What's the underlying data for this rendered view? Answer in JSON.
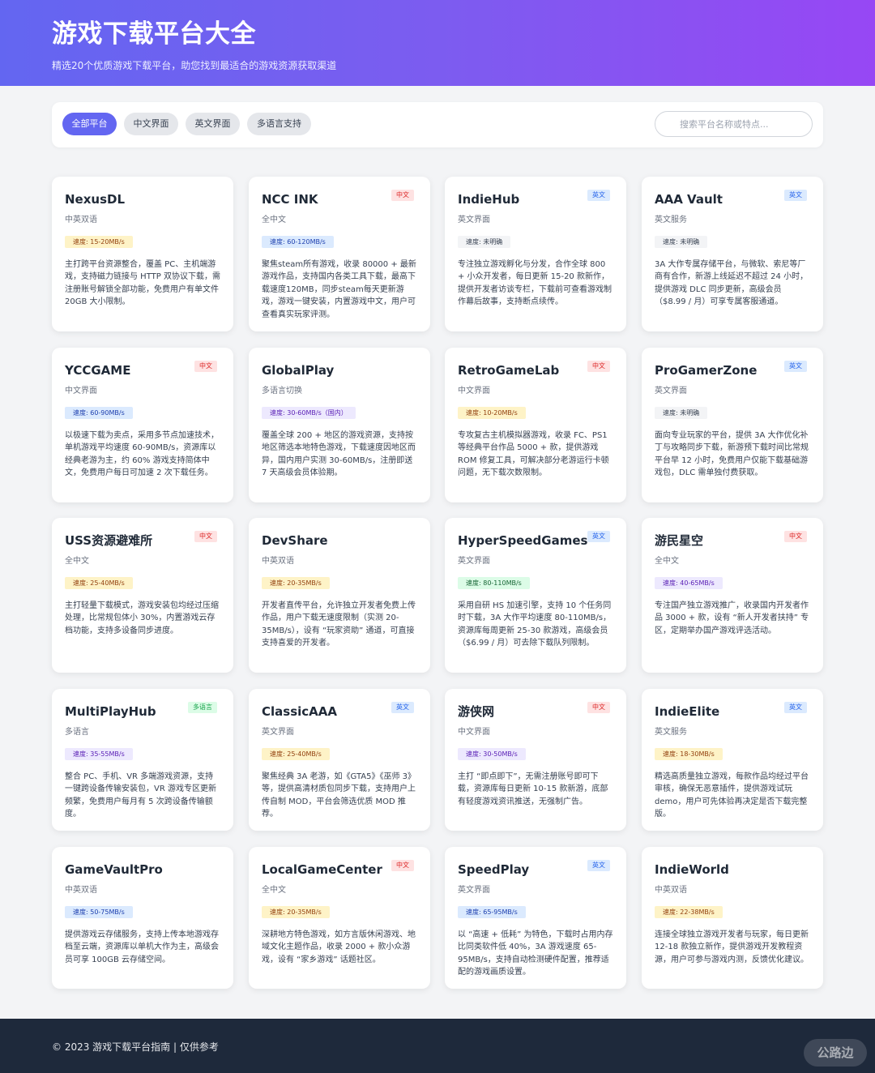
{
  "header": {
    "title": "游戏下载平台大全",
    "subtitle": "精选20个优质游戏下载平台，助您找到最适合的游戏资源获取渠道"
  },
  "filters": [
    {
      "label": "全部平台",
      "active": true
    },
    {
      "label": "中文界面",
      "active": false
    },
    {
      "label": "英文界面",
      "active": false
    },
    {
      "label": "多语言支持",
      "active": false
    }
  ],
  "search": {
    "placeholder": "搜索平台名称或特点...",
    "value": ""
  },
  "cards": [
    {
      "name": "NexusDL",
      "tag": "",
      "tag_type": "",
      "lang": "中英双语",
      "speed": "速度: 15-20MB/s",
      "speed_color": "yellow",
      "desc": "主打跨平台资源整合，覆盖 PC、主机端游戏，支持磁力链接与 HTTP 双协议下载，需注册账号解锁全部功能，免费用户有单文件 20GB 大小限制。"
    },
    {
      "name": "NCC INK",
      "tag": "中文",
      "tag_type": "zh",
      "lang": "全中文",
      "speed": "速度: 60-120MB/s",
      "speed_color": "blue",
      "desc": "聚焦steam所有游戏，收录 80000 + 最新游戏作品，支持国内各类工具下载，最高下载速度120MB，同步steam每天更新游戏，游戏一键安装，内置游戏中文，用户可查看真实玩家评测。"
    },
    {
      "name": "IndieHub",
      "tag": "英文",
      "tag_type": "en",
      "lang": "英文界面",
      "speed": "速度: 未明确",
      "speed_color": "gray",
      "desc": "专注独立游戏孵化与分发，合作全球 800 + 小众开发者，每日更新 15-20 款新作，提供开发者访谈专栏，下载前可查看游戏制作幕后故事，支持断点续传。"
    },
    {
      "name": "AAA Vault",
      "tag": "英文",
      "tag_type": "en",
      "lang": "英文服务",
      "speed": "速度: 未明确",
      "speed_color": "gray",
      "desc": "3A 大作专属存储平台，与微软、索尼等厂商有合作，新游上线延迟不超过 24 小时，提供游戏 DLC 同步更新，高级会员（$8.99 / 月）可享专属客服通道。"
    },
    {
      "name": "YCCGAME",
      "tag": "中文",
      "tag_type": "zh",
      "lang": "中文界面",
      "speed": "速度: 60-90MB/s",
      "speed_color": "blue",
      "desc": "以极速下载为卖点，采用多节点加速技术，单机游戏平均速度 60-90MB/s，资源库以经典老游为主，约 60% 游戏支持简体中文，免费用户每日可加速 2 次下载任务。"
    },
    {
      "name": "GlobalPlay",
      "tag": "",
      "tag_type": "",
      "lang": "多语言切换",
      "speed": "速度: 30-60MB/s（国内）",
      "speed_color": "purple",
      "desc": "覆盖全球 200 + 地区的游戏资源，支持按地区筛选本地特色游戏，下载速度因地区而异，国内用户实测 30-60MB/s，注册即送 7 天高级会员体验期。"
    },
    {
      "name": "RetroGameLab",
      "tag": "中文",
      "tag_type": "zh",
      "lang": "中文界面",
      "speed": "速度: 10-20MB/s",
      "speed_color": "yellow",
      "desc": "专攻复古主机模拟器游戏，收录 FC、PS1 等经典平台作品 5000 + 款，提供游戏 ROM 修复工具，可解决部分老游运行卡顿问题，无下载次数限制。"
    },
    {
      "name": "ProGamerZone",
      "tag": "英文",
      "tag_type": "en",
      "lang": "英文界面",
      "speed": "速度: 未明确",
      "speed_color": "gray",
      "desc": "面向专业玩家的平台，提供 3A 大作优化补丁与攻略同步下载，新游预下载时间比常规平台早 12 小时，免费用户仅能下载基础游戏包，DLC 需单独付费获取。"
    },
    {
      "name": "USS资源避难所",
      "tag": "中文",
      "tag_type": "zh",
      "lang": "全中文",
      "speed": "速度: 25-40MB/s",
      "speed_color": "yellow",
      "desc": "主打轻量下载模式，游戏安装包均经过压缩处理，比常规包体小 30%，内置游戏云存档功能，支持多设备同步进度。"
    },
    {
      "name": "DevShare",
      "tag": "",
      "tag_type": "",
      "lang": "中英双语",
      "speed": "速度: 20-35MB/s",
      "speed_color": "yellow",
      "desc": "开发者直传平台，允许独立开发者免费上传作品，用户下载无速度限制（实测 20-35MB/s），设有 “玩家资助” 通道，可直接支持喜爱的开发者。"
    },
    {
      "name": "HyperSpeedGames",
      "tag": "英文",
      "tag_type": "en",
      "lang": "英文界面",
      "speed": "速度: 80-110MB/s",
      "speed_color": "green",
      "desc": "采用自研 HS 加速引擎，支持 10 个任务同时下载，3A 大作平均速度 80-110MB/s，资源库每周更新 25-30 款游戏，高级会员（$6.99 / 月）可去除下载队列限制。"
    },
    {
      "name": "游民星空",
      "tag": "中文",
      "tag_type": "zh",
      "lang": "全中文",
      "speed": "速度: 40-65MB/s",
      "speed_color": "purple",
      "desc": "专注国产独立游戏推广，收录国内开发者作品 3000 + 款，设有 “新人开发者扶持” 专区，定期举办国产游戏评选活动。"
    },
    {
      "name": "MultiPlayHub",
      "tag": "多语言",
      "tag_type": "multi",
      "lang": "多语言",
      "speed": "速度: 35-55MB/s",
      "speed_color": "purple",
      "desc": "整合 PC、手机、VR 多端游戏资源，支持一键跨设备传输安装包，VR 游戏专区更新频繁，免费用户每月有 5 次跨设备传输额度。"
    },
    {
      "name": "ClassicAAA",
      "tag": "英文",
      "tag_type": "en",
      "lang": "英文界面",
      "speed": "速度: 25-40MB/s",
      "speed_color": "yellow",
      "desc": "聚焦经典 3A 老游，如《GTA5》《巫师 3》等，提供高清材质包同步下载，支持用户上传自制 MOD，平台会筛选优质 MOD 推荐。"
    },
    {
      "name": "游侠网",
      "tag": "中文",
      "tag_type": "zh",
      "lang": "中文界面",
      "speed": "速度: 30-50MB/s",
      "speed_color": "purple",
      "desc": "主打 “即点即下”，无需注册账号即可下载，资源库每日更新 10-15 款新游，底部有轻度游戏资讯推送，无强制广告。"
    },
    {
      "name": "IndieElite",
      "tag": "英文",
      "tag_type": "en",
      "lang": "英文服务",
      "speed": "速度: 18-30MB/s",
      "speed_color": "yellow",
      "desc": "精选高质量独立游戏，每款作品均经过平台审核，确保无恶意插件，提供游戏试玩 demo，用户可先体验再决定是否下载完整版。"
    },
    {
      "name": "GameVaultPro",
      "tag": "",
      "tag_type": "",
      "lang": "中英双语",
      "speed": "速度: 50-75MB/s",
      "speed_color": "blue",
      "desc": "提供游戏云存储服务，支持上传本地游戏存档至云端，资源库以单机大作为主，高级会员可享 100GB 云存储空间。"
    },
    {
      "name": "LocalGameCenter",
      "tag": "中文",
      "tag_type": "zh",
      "lang": "全中文",
      "speed": "速度: 20-35MB/s",
      "speed_color": "yellow",
      "desc": "深耕地方特色游戏，如方言版休闲游戏、地域文化主题作品，收录 2000 + 款小众游戏，设有 “家乡游戏” 话题社区。"
    },
    {
      "name": "SpeedPlay",
      "tag": "英文",
      "tag_type": "en",
      "lang": "英文界面",
      "speed": "速度: 65-95MB/s",
      "speed_color": "blue",
      "desc": "以 “高速 + 低耗” 为特色，下载时占用内存比同类软件低 40%，3A 游戏速度 65-95MB/s，支持自动检测硬件配置，推荐适配的游戏画质设置。"
    },
    {
      "name": "IndieWorld",
      "tag": "",
      "tag_type": "",
      "lang": "中英双语",
      "speed": "速度: 22-38MB/s",
      "speed_color": "yellow",
      "desc": "连接全球独立游戏开发者与玩家，每日更新 12-18 款独立新作，提供游戏开发教程资源，用户可参与游戏内测，反馈优化建议。"
    }
  ],
  "footer": {
    "text": "© 2023 游戏下载平台指南 | 仅供参考"
  },
  "watermark": {
    "text": "公路边"
  },
  "colors": {
    "header_gradient_start": "#6366f1",
    "header_gradient_end": "#9747f4",
    "accent": "#6366f1",
    "footer_bg": "#1e293b"
  }
}
